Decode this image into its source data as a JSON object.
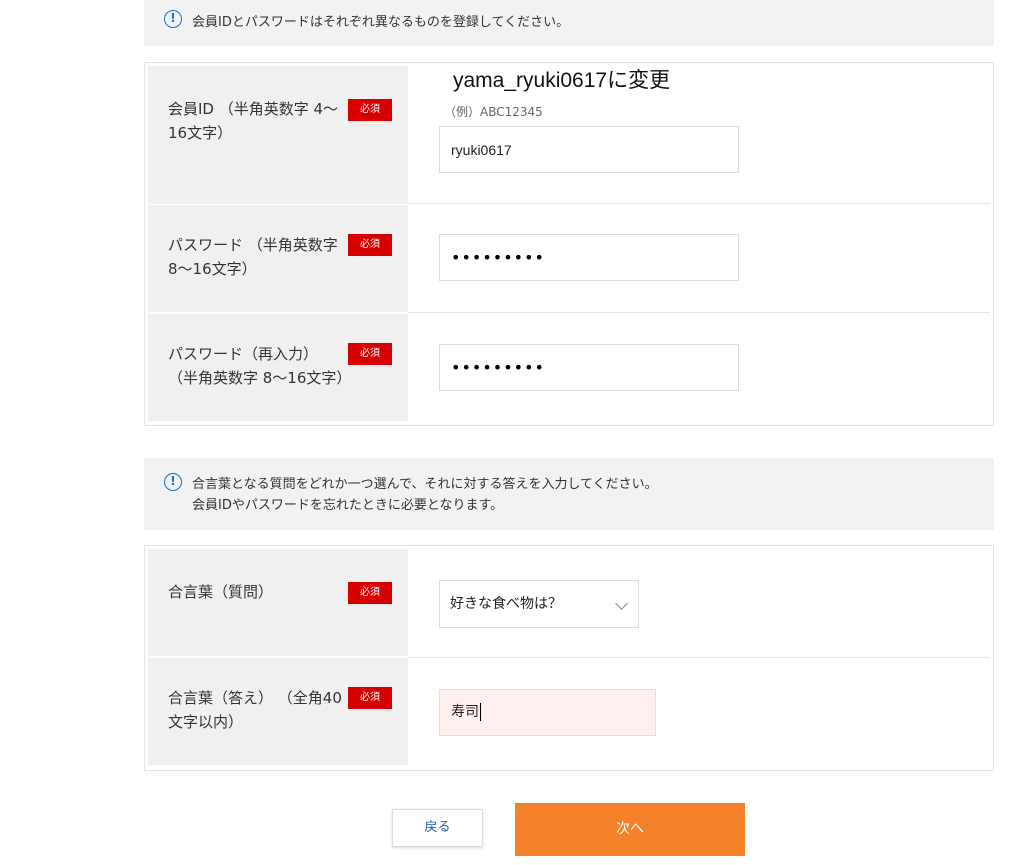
{
  "notices": {
    "top": "会員IDとパスワードはそれぞれ異なるものを登録してください。",
    "bottom_line1": "合言葉となる質問をどれか一つ選んで、それに対する答えを入力してください。",
    "bottom_line2": "会員IDやパスワードを忘れたときに必要となります。",
    "icon": "info-circle-icon"
  },
  "annotation": "yama_ryuki0617に変更",
  "required_badge": "必須",
  "member_id": {
    "label": "会員ID （半角英数字 4～16文字）",
    "example": "（例）ABC12345",
    "value": "ryuki0617"
  },
  "password": {
    "label": "パスワード （半角英数字 8～16文字）",
    "value": "•••••••••"
  },
  "password_confirm": {
    "label_line1": "パスワード（再入力）",
    "label_line2": "（半角英数字 8～16文字）",
    "value": "•••••••••"
  },
  "secret_question": {
    "label": "合言葉（質問）",
    "selected": "好きな食べ物は？"
  },
  "secret_answer": {
    "label": "合言葉（答え） （全角40文字以内）",
    "value": "寿司"
  },
  "buttons": {
    "back": "戻る",
    "next": "次へ"
  },
  "colors": {
    "required_badge": "#d60000",
    "next_button": "#f5802a",
    "info_icon": "#1a6fd1",
    "label_bg": "#f0f0f0",
    "answer_bg": "#fff0f0"
  }
}
